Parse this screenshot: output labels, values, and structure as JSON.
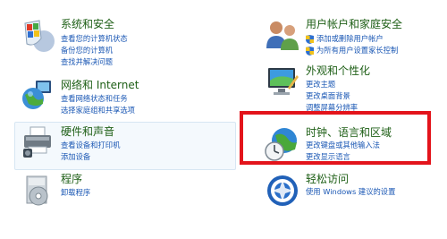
{
  "categories": {
    "system": {
      "title": "系统和安全",
      "links": [
        "查看您的计算机状态",
        "备份您的计算机",
        "查找并解决问题"
      ]
    },
    "network": {
      "title": "网络和 Internet",
      "links": [
        "查看网络状态和任务",
        "选择家庭组和共享选项"
      ]
    },
    "hardware": {
      "title": "硬件和声音",
      "links": [
        "查看设备和打印机",
        "添加设备"
      ]
    },
    "programs": {
      "title": "程序",
      "links": [
        "卸载程序"
      ]
    },
    "user": {
      "title": "用户帐户和家庭安全",
      "links": [
        "添加或删除用户帐户",
        "为所有用户设置家长控制"
      ]
    },
    "appearance": {
      "title": "外观和个性化",
      "links": [
        "更改主题",
        "更改桌面背景",
        "调整屏幕分辨率"
      ]
    },
    "clock": {
      "title": "时钟、语言和区域",
      "links": [
        "更改键盘或其他输入法",
        "更改显示语言"
      ]
    },
    "ease": {
      "title": "轻松访问",
      "links": [
        "使用 Windows 建议的设置"
      ]
    }
  },
  "colors": {
    "title_green": "#1e5f16",
    "link_blue": "#1a57b4",
    "highlight_red": "#e3141b"
  },
  "icons": {
    "system": "security-shield-icon",
    "network": "network-globe-icon",
    "hardware": "printer-icon",
    "programs": "programs-disc-icon",
    "user": "users-icon",
    "appearance": "monitor-personalization-icon",
    "clock": "clock-globe-icon",
    "ease": "ease-of-access-icon"
  }
}
